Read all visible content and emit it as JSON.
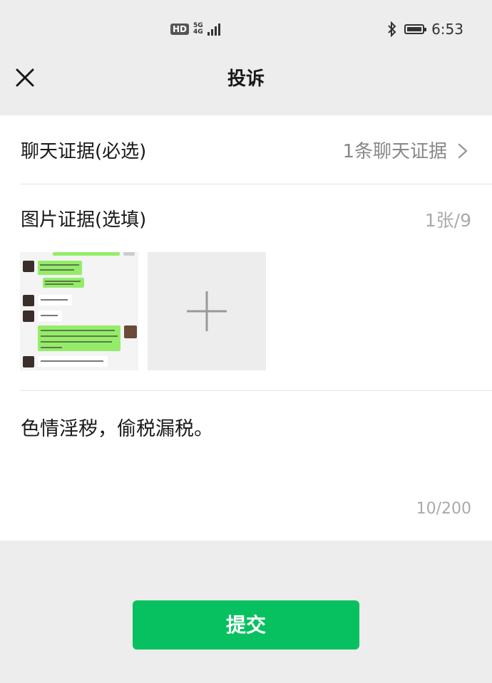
{
  "status_bar": {
    "hd": "HD",
    "network_top": "5G",
    "network_bottom": "4G",
    "time": "6:53"
  },
  "nav": {
    "title": "投诉",
    "close_icon": "close-icon"
  },
  "chat_evidence": {
    "label": "聊天证据(必选)",
    "value": "1条聊天证据",
    "chevron_icon": "chevron-right-icon"
  },
  "image_evidence": {
    "label": "图片证据(选填)",
    "count": "1张/9",
    "add_icon": "plus-icon"
  },
  "description": {
    "text": "色情淫秽，偷税漏税。",
    "char_count": "10/200"
  },
  "submit": {
    "label": "提交"
  },
  "colors": {
    "accent": "#07c160",
    "background": "#ededed",
    "card": "#ffffff",
    "secondary_text": "#888888"
  }
}
